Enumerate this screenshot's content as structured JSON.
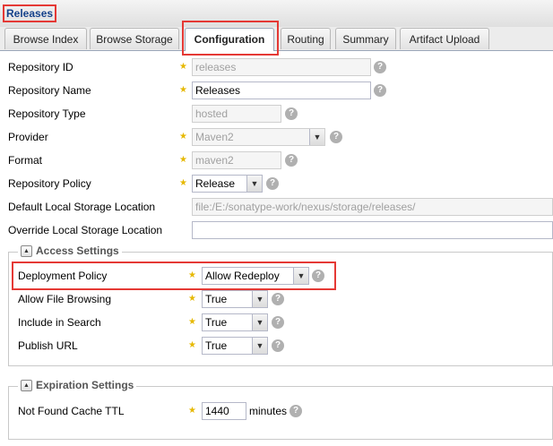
{
  "panel": {
    "title": "Releases"
  },
  "tabs": [
    {
      "label": "Browse Index"
    },
    {
      "label": "Browse Storage"
    },
    {
      "label": "Configuration"
    },
    {
      "label": "Routing"
    },
    {
      "label": "Summary"
    },
    {
      "label": "Artifact Upload"
    }
  ],
  "fields": {
    "repository_id": {
      "label": "Repository ID",
      "value": "releases"
    },
    "repository_name": {
      "label": "Repository Name",
      "value": "Releases"
    },
    "repository_type": {
      "label": "Repository Type",
      "value": "hosted"
    },
    "provider": {
      "label": "Provider",
      "value": "Maven2"
    },
    "format": {
      "label": "Format",
      "value": "maven2"
    },
    "repository_policy": {
      "label": "Repository Policy",
      "value": "Release"
    },
    "default_local_storage": {
      "label": "Default Local Storage Location",
      "value": "file:/E:/sonatype-work/nexus/storage/releases/"
    },
    "override_local_storage": {
      "label": "Override Local Storage Location",
      "value": ""
    }
  },
  "access_settings": {
    "legend": "Access Settings",
    "deployment_policy": {
      "label": "Deployment Policy",
      "value": "Allow Redeploy"
    },
    "allow_file_browsing": {
      "label": "Allow File Browsing",
      "value": "True"
    },
    "include_in_search": {
      "label": "Include in Search",
      "value": "True"
    },
    "publish_url": {
      "label": "Publish URL",
      "value": "True"
    }
  },
  "expiration_settings": {
    "legend": "Expiration Settings",
    "not_found_cache_ttl": {
      "label": "Not Found Cache TTL",
      "value": "1440",
      "unit": "minutes"
    }
  },
  "icons": {
    "required": "star-icon",
    "help": "help-icon",
    "collapse": "collapse-icon",
    "dropdown": "chevron-down-icon"
  },
  "colors": {
    "highlight": "#e53935",
    "title": "#15428b",
    "required_star": "#e6b800"
  }
}
